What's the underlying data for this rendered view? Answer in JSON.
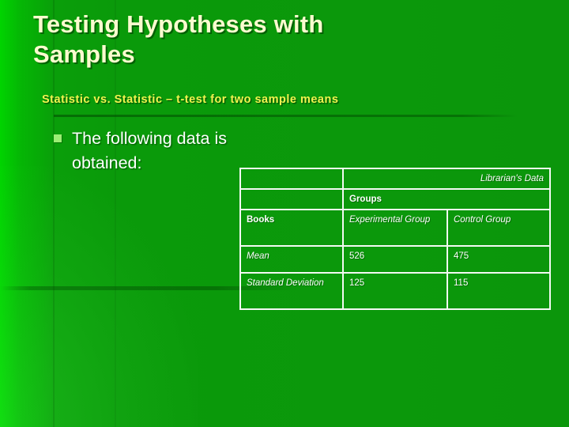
{
  "slide": {
    "title": "Testing Hypotheses with\nSamples",
    "subtitle": "Statistic vs. Statistic – t-test for two sample means",
    "bullet": {
      "marker": "square-bullet-icon",
      "text": "The following data is obtained:"
    },
    "colors": {
      "background_left": "#00d400",
      "background_right": "#0b960b",
      "title_text": "#fbfbcf",
      "subtitle_text": "#f2f24f",
      "body_text": "#ffffff",
      "bullet_marker": "#9bee74",
      "table_border": "#f3f9f3"
    }
  },
  "table": {
    "rows": [
      {
        "cells": [
          {
            "text": "",
            "style": "empty"
          },
          {
            "text": "Librarian's Data",
            "style": "right-italic",
            "colspan": 2
          }
        ]
      },
      {
        "cells": [
          {
            "text": "",
            "style": "empty"
          },
          {
            "text": "Groups",
            "style": "bold",
            "colspan": 2
          }
        ]
      },
      {
        "cells": [
          {
            "text": "Books",
            "style": "bold"
          },
          {
            "text": "Experimental Group",
            "style": "italic"
          },
          {
            "text": "Control Group",
            "style": "italic"
          }
        ]
      },
      {
        "cells": [
          {
            "text": "Mean",
            "style": "italic"
          },
          {
            "text": "526",
            "style": "plain"
          },
          {
            "text": "475",
            "style": "plain"
          }
        ]
      },
      {
        "cells": [
          {
            "text": "Standard Deviation",
            "style": "italic"
          },
          {
            "text": "125",
            "style": "plain"
          },
          {
            "text": "115",
            "style": "plain"
          }
        ]
      }
    ]
  }
}
